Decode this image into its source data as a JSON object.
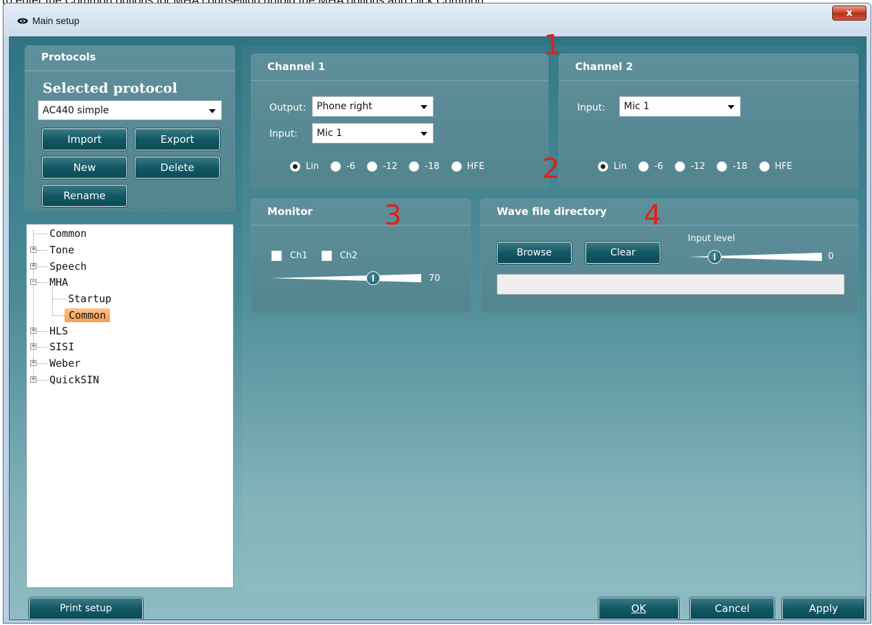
{
  "caption": "To enter the Common options for MHA counselling unfold the MHA options and click Common.",
  "window": {
    "title": "Main setup",
    "close_label": "x"
  },
  "protocols": {
    "title": "Protocols",
    "selected_label": "Selected protocol",
    "selected_value": "AC440 simple",
    "buttons": {
      "import": "Import",
      "export": "Export",
      "new": "New",
      "delete": "Delete",
      "rename": "Rename"
    }
  },
  "tree": {
    "items": [
      {
        "label": "Common"
      },
      {
        "label": "Tone",
        "expander": "+"
      },
      {
        "label": "Speech",
        "expander": "+"
      },
      {
        "label": "MHA",
        "expander": "−"
      },
      {
        "label": "Startup"
      },
      {
        "label": "Common",
        "selected": true
      },
      {
        "label": "HLS",
        "expander": "+"
      },
      {
        "label": "SISI",
        "expander": "+"
      },
      {
        "label": "Weber",
        "expander": "+"
      },
      {
        "label": "QuickSIN",
        "expander": "+"
      }
    ]
  },
  "channel1": {
    "title": "Channel 1",
    "output_label": "Output:",
    "output_value": "Phone right",
    "input_label": "Input:",
    "input_value": "Mic 1",
    "filters": [
      {
        "label": "Lin",
        "selected": true
      },
      {
        "label": "-6"
      },
      {
        "label": "-12"
      },
      {
        "label": "-18"
      },
      {
        "label": "HFE"
      }
    ]
  },
  "channel2": {
    "title": "Channel 2",
    "input_label": "Input:",
    "input_value": "Mic 1",
    "filters": [
      {
        "label": "Lin",
        "selected": true
      },
      {
        "label": "-6"
      },
      {
        "label": "-12"
      },
      {
        "label": "-18"
      },
      {
        "label": "HFE"
      }
    ]
  },
  "monitor": {
    "title": "Monitor",
    "ch1_label": "Ch1",
    "ch2_label": "Ch2",
    "ch1_checked": false,
    "ch2_checked": false,
    "level_value": "70",
    "level_fraction": 0.68
  },
  "wave": {
    "title": "Wave file directory",
    "browse": "Browse",
    "clear": "Clear",
    "input_level_label": "Input level",
    "input_level_value": "0",
    "input_level_fraction": 0.2,
    "path": ""
  },
  "annotations": [
    "1",
    "2",
    "3",
    "4"
  ],
  "footer": {
    "print_setup": "Print setup",
    "ok": "OK",
    "cancel": "Cancel",
    "apply": "Apply"
  }
}
